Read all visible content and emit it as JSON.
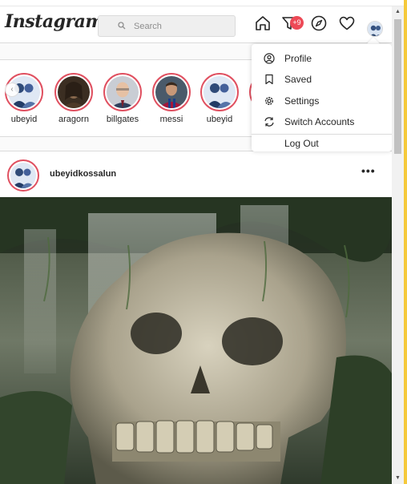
{
  "navbar": {
    "logo": "Instagram",
    "search_placeholder": "Search",
    "notification_badge": "+9",
    "icons": [
      "home-icon",
      "direct-filter-icon",
      "explore-compass-icon",
      "activity-heart-icon",
      "profile-avatar"
    ]
  },
  "stories": [
    {
      "username": "ubeyid"
    },
    {
      "username": "aragorn"
    },
    {
      "username": "billgates"
    },
    {
      "username": "messi"
    },
    {
      "username": "ubeyid"
    }
  ],
  "dropdown": {
    "items": [
      {
        "label": "Profile",
        "icon": "user-circle-icon"
      },
      {
        "label": "Saved",
        "icon": "bookmark-icon"
      },
      {
        "label": "Settings",
        "icon": "settings-gear-icon"
      },
      {
        "label": "Switch Accounts",
        "icon": "switch-arrows-icon"
      },
      {
        "label": "Log Out",
        "icon": ""
      }
    ]
  },
  "post": {
    "username": "ubeyidkossalun",
    "more_label": "•••"
  },
  "colors": {
    "story_ring": "#e05060",
    "badge": "#ed4956",
    "border": "#dbdbdb"
  }
}
